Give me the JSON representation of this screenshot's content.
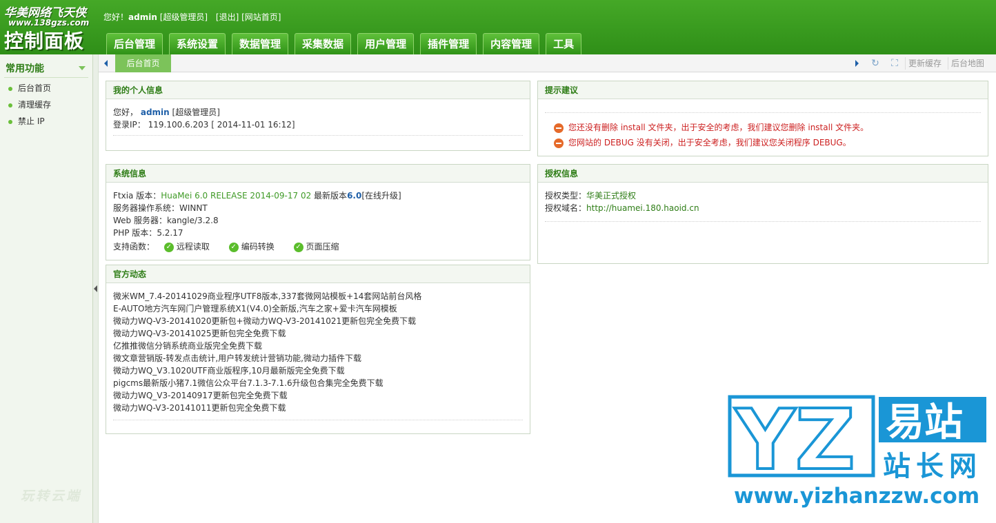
{
  "header": {
    "logo_line1": "华美网络飞天侠",
    "logo_line2": "www.138gzs.com",
    "logo_line3": "控制面板",
    "greeting": "您好！",
    "username": "admin",
    "role": "[超级管理员]",
    "logout": "[退出]",
    "site_home": "[网站首页]"
  },
  "nav": {
    "tabs": [
      "后台管理",
      "系统设置",
      "数据管理",
      "采集数据",
      "用户管理",
      "插件管理",
      "内容管理",
      "工具"
    ]
  },
  "sidebar": {
    "title": "常用功能",
    "items": [
      "后台首页",
      "清理缓存",
      "禁止 IP"
    ],
    "watermark": "玩转云端"
  },
  "tabstrip": {
    "active_tab": "后台首页",
    "refresh_icon": "refresh-icon",
    "fullscreen_icon": "fullscreen-icon",
    "update_cache": "更新缓存",
    "site_map": "后台地图"
  },
  "panels": {
    "personal": {
      "title": "我的个人信息",
      "greeting": "您好，",
      "username": "admin",
      "role": "[超级管理员]",
      "login_ip_label": "登录IP：",
      "login_ip_value": "119.100.6.203 [ 2014-11-01 16:12]"
    },
    "tips": {
      "title": "提示建议",
      "items": [
        "您还没有删除 install 文件夹，出于安全的考虑，我们建议您删除 install 文件夹。",
        "您网站的 DEBUG 没有关闭，出于安全考虑，我们建议您关闭程序 DEBUG。"
      ]
    },
    "system": {
      "title": "系统信息",
      "ftxia_label": "Ftxia 版本：",
      "ftxia_version": "HuaMei 6.0 RELEASE 2014-09-17 02",
      "latest_label": "最新版本",
      "latest_version": "6.0",
      "upgrade": "[在线升级]",
      "os_label": "服务器操作系统：",
      "os_value": "WINNT",
      "web_label": "Web 服务器：",
      "web_value": "kangle/3.2.8",
      "php_label": "PHP 版本：",
      "php_value": "5.2.17",
      "support_label": "支持函数：",
      "supports": [
        "远程读取",
        "编码转换",
        "页面压缩"
      ]
    },
    "license": {
      "title": "授权信息",
      "type_label": "授权类型：",
      "type_value": "华美正式授权",
      "domain_label": "授权域名：",
      "domain_value": "http://huamei.180.haoid.cn"
    },
    "news": {
      "title": "官方动态",
      "items": [
        "微米WM_7.4-20141029商业程序UTF8版本,337套微网站模板+14套网站前台风格",
        "E-AUTO地方汽车网门户管理系统X1(V4.0)全新版,汽车之家+爱卡汽车网模板",
        "微动力WQ-V3-20141020更新包+微动力WQ-V3-20141021更新包完全免费下载",
        "微动力WQ-V3-20141025更新包完全免费下载",
        "亿推推微信分销系统商业版完全免费下载",
        "微文章营销版-转发点击统计,用户转发统计营销功能,微动力插件下载",
        "微动力WQ_V3.1020UTF商业版程序,10月最新版完全免费下载",
        "pigcms最新版小猪7.1微信公众平台7.1.3-7.1.6升级包合集完全免费下载",
        "微动力WQ_V3-20140917更新包完全免费下载",
        "微动力WQ-V3-20141011更新包完全免费下载"
      ]
    }
  },
  "watermark_logo": {
    "letters": "YZ",
    "cn_big": "易站",
    "cn_small": "站长网",
    "url": "www.yizhanzzw.com",
    "color": "#1a96d6"
  },
  "colors": {
    "header_green": "#3a9b1f",
    "panel_title": "#2e7d16",
    "warning_red": "#cc1f1f",
    "link_blue": "#1e5fa8"
  }
}
